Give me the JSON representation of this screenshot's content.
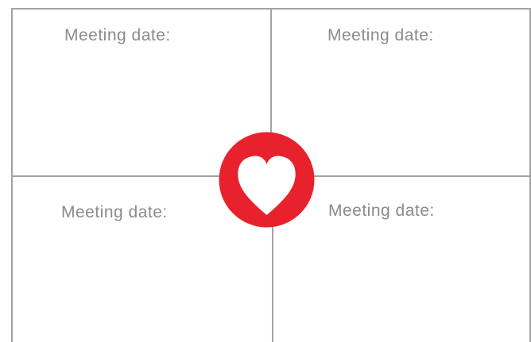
{
  "quadrants": {
    "top_left_label": "Meeting date:",
    "top_right_label": "Meeting date:",
    "bottom_left_label": "Meeting date:",
    "bottom_right_label": "Meeting date:"
  },
  "colors": {
    "badge": "#e8222c",
    "heart": "#ffffff",
    "grid_lines": "#a3a3a3",
    "label_text": "#8b8b8b"
  },
  "icons": {
    "center": "heart-icon"
  }
}
